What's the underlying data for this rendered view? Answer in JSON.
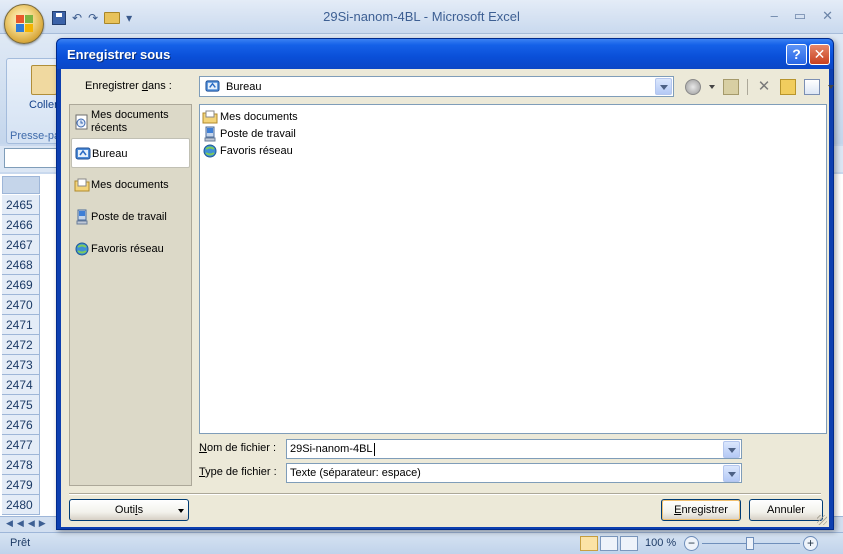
{
  "excel": {
    "window_title": "29Si-nanom-4BL - Microsoft Excel",
    "ribbon": {
      "paste_label": "Coller",
      "clipboard_group": "Presse-pa"
    },
    "row_numbers": [
      "2465",
      "2466",
      "2467",
      "2468",
      "2469",
      "2470",
      "2471",
      "2472",
      "2473",
      "2474",
      "2475",
      "2476",
      "2477",
      "2478",
      "2479",
      "2480"
    ],
    "status": "Prêt",
    "zoom": "100 %"
  },
  "dialog": {
    "title": "Enregistrer sous",
    "help": "?",
    "close": "✕",
    "save_in_label_before": "Enregistrer ",
    "save_in_label_u": "d",
    "save_in_label_after": "ans :",
    "save_in_value": "Bureau",
    "places": [
      {
        "line1": "Mes documents",
        "line2": "récents",
        "icon": "recent-documents-icon"
      },
      {
        "line1": "Bureau",
        "line2": "",
        "icon": "desktop-icon"
      },
      {
        "line1": "Mes documents",
        "line2": "",
        "icon": "my-documents-icon"
      },
      {
        "line1": "Poste de travail",
        "line2": "",
        "icon": "my-computer-icon"
      },
      {
        "line1": "Favoris réseau",
        "line2": "",
        "icon": "network-places-icon"
      }
    ],
    "files": [
      {
        "name": "Mes documents",
        "icon": "folder-icon"
      },
      {
        "name": "Poste de travail",
        "icon": "computer-icon"
      },
      {
        "name": "Favoris réseau",
        "icon": "network-icon"
      }
    ],
    "file_name_label_u": "N",
    "file_name_label_rest": "om de fichier :",
    "file_name_value": "29Si-nanom-4BL",
    "file_type_label_u": "T",
    "file_type_label_rest": "ype de fichier :",
    "file_type_value": "Texte (séparateur: espace)",
    "tools_button_pre": "Outi",
    "tools_button_u": "l",
    "tools_button_post": "s",
    "save_button_u": "E",
    "save_button_rest": "nregistrer",
    "cancel_button": "Annuler"
  },
  "colors": {
    "dialog_title_blue": "#0a4fd8",
    "dialog_body": "#ece9d8",
    "excel_chrome": "#c9d9ee"
  }
}
